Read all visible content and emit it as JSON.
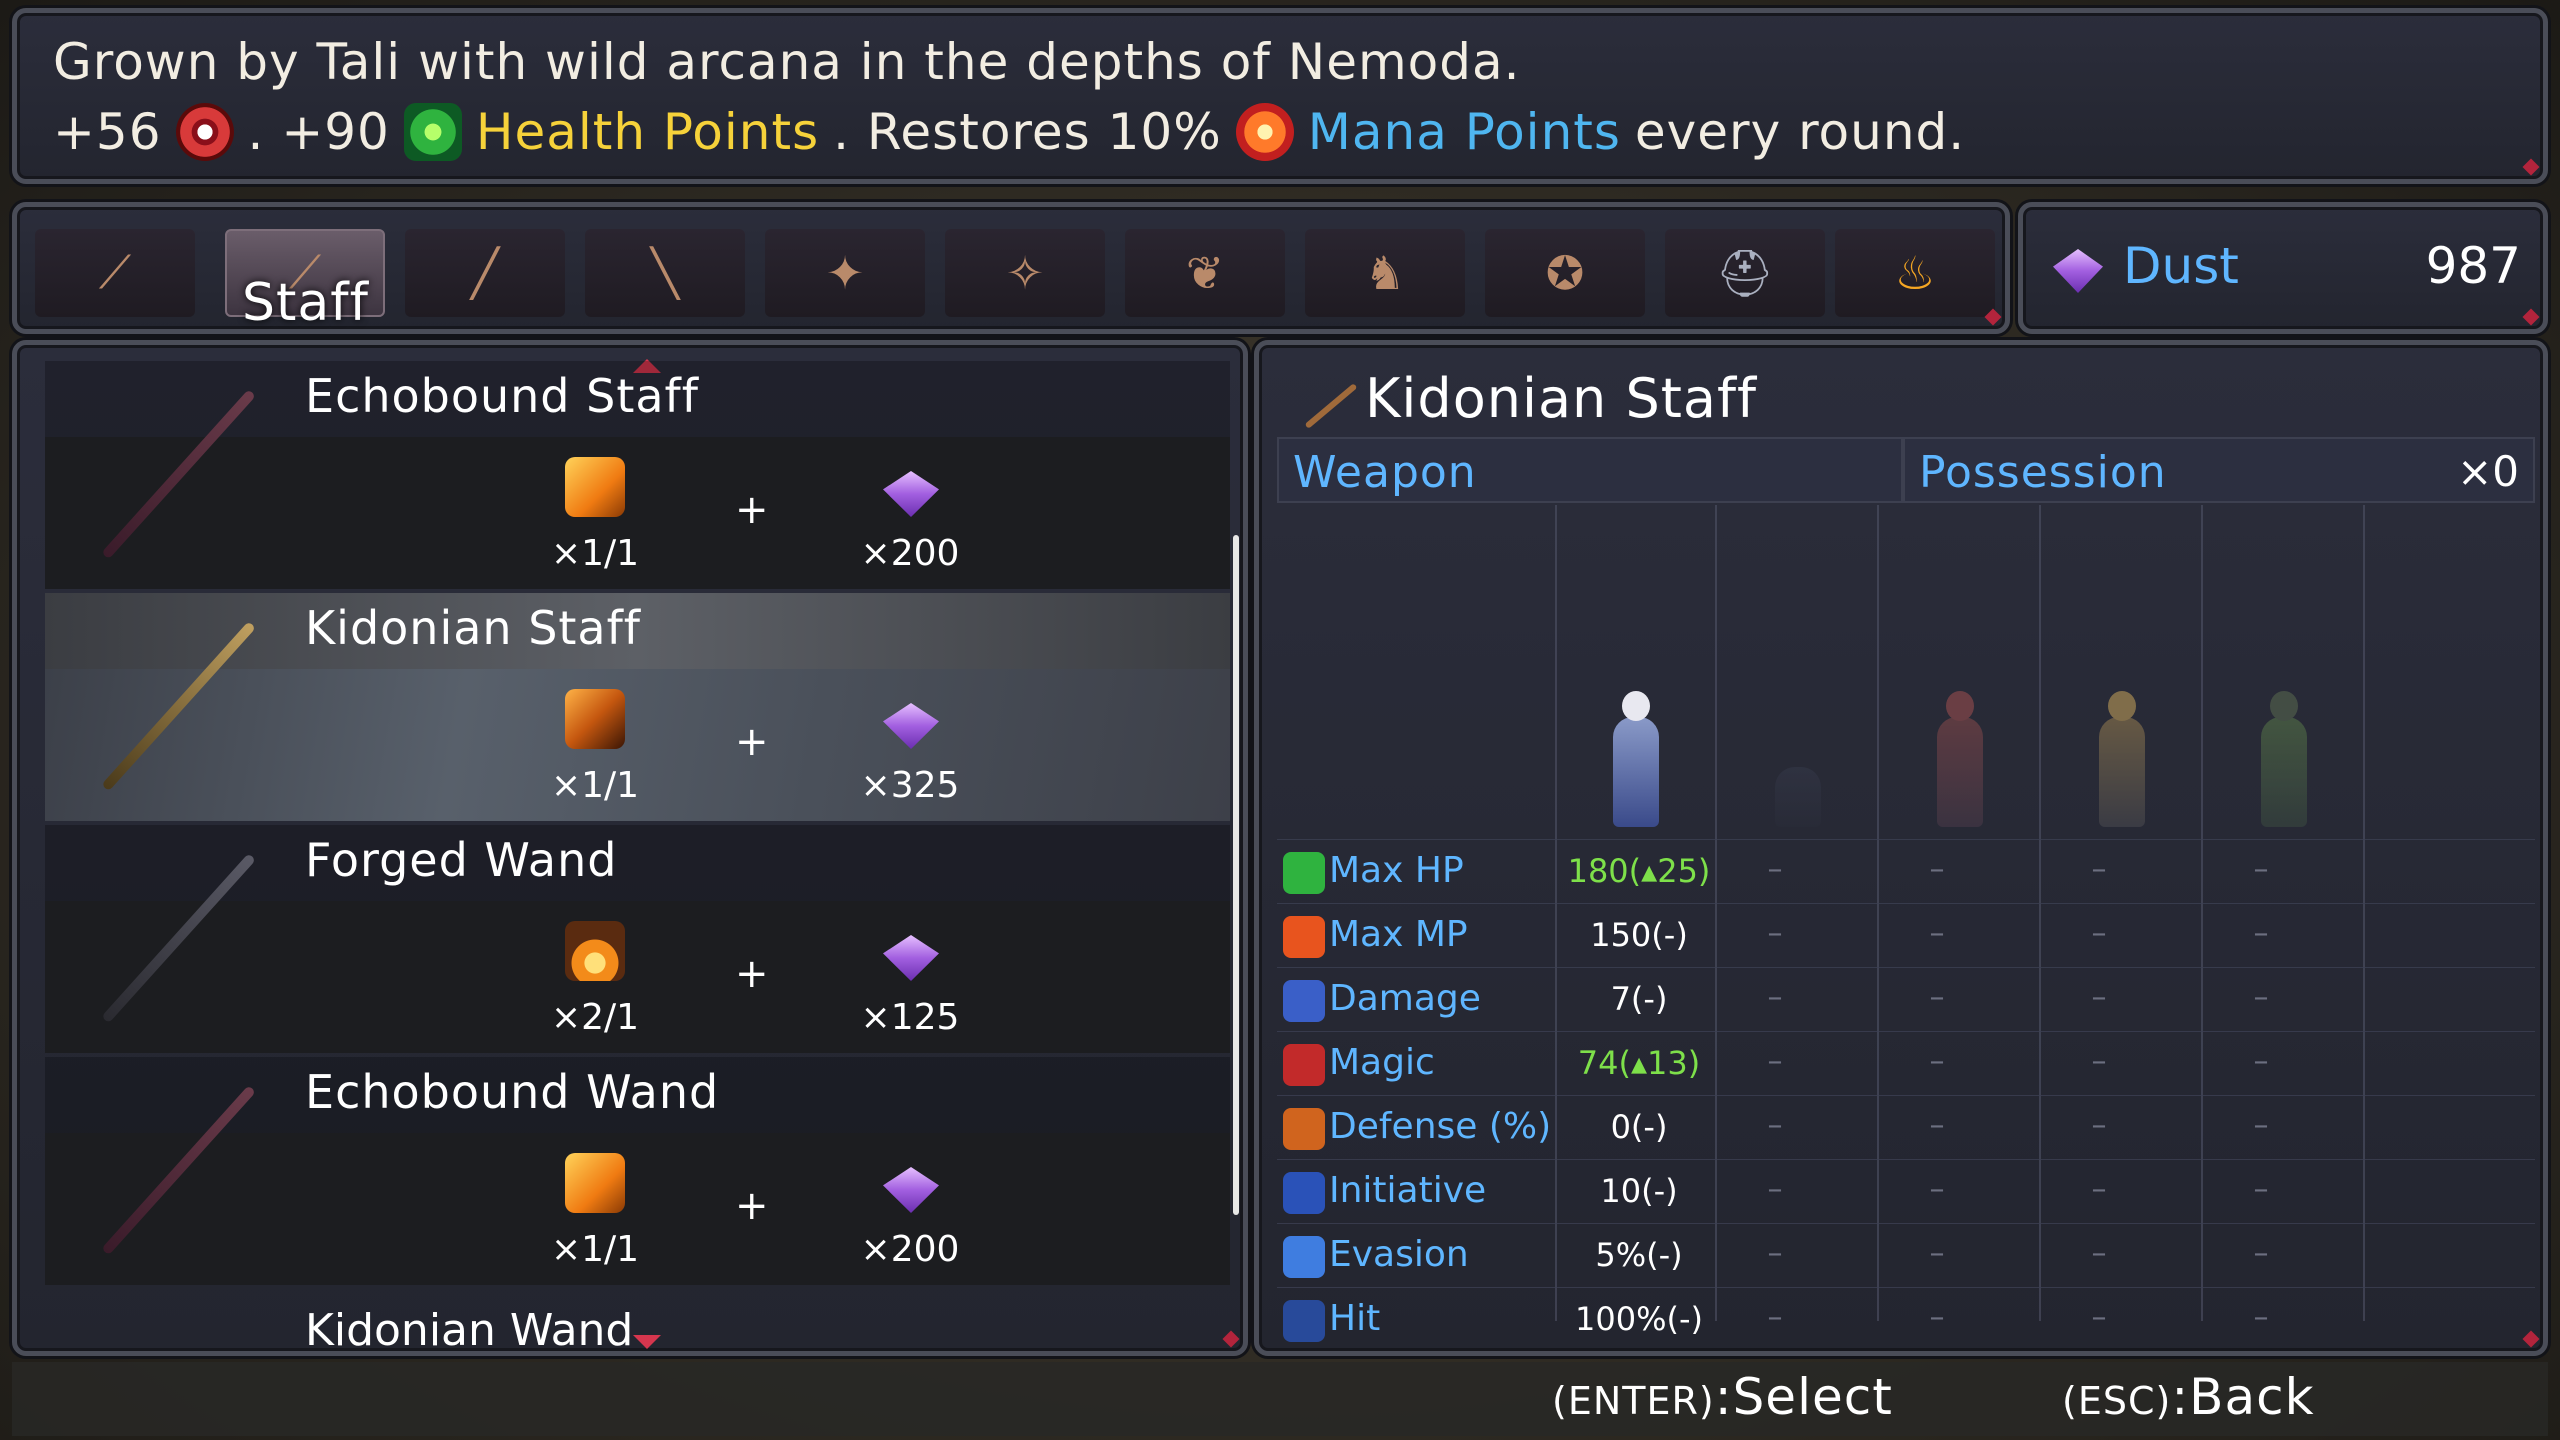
{
  "description": {
    "line1": "Grown by Tali with wild arcana in the depths of Nemoda.",
    "line2_prefix": "+56",
    "line2_sep": ". +90",
    "health_points": "Health Points",
    "restores": ". Restores 10%",
    "mana_points": "Mana Points",
    "every_round": "every round.",
    "icons": [
      "magic-eye-icon",
      "health-leaf-icon",
      "mana-orb-icon"
    ]
  },
  "tabs": {
    "active_label": "Staff",
    "items": [
      "staff",
      "wand",
      "blade",
      "dagger",
      "gloves",
      "robe",
      "boots",
      "bracers",
      "armor",
      "helmet",
      "ember"
    ]
  },
  "dust": {
    "label": "Dust",
    "value": "987"
  },
  "recipes": [
    {
      "name": "Echobound Staff",
      "material_count": "×1/1",
      "dust_count": "×200",
      "material_icon": "amber-shard-icon"
    },
    {
      "name": "Kidonian Staff",
      "material_count": "×1/1",
      "dust_count": "×325",
      "material_icon": "bark-plank-icon"
    },
    {
      "name": "Forged Wand",
      "material_count": "×2/1",
      "dust_count": "×125",
      "material_icon": "ember-icon"
    },
    {
      "name": "Echobound Wand",
      "material_count": "×1/1",
      "dust_count": "×200",
      "material_icon": "amber-shard-icon"
    }
  ],
  "recipe_partial": "Kidonian Wand",
  "plus": "+",
  "detail": {
    "title": "Kidonian Staff",
    "type_label": "Weapon",
    "possession_label": "Possession",
    "possession_count": "×0",
    "stats": [
      {
        "label": "Max HP",
        "value": "180(▴25)",
        "up": true,
        "icon_color": "#2fb33f"
      },
      {
        "label": "Max MP",
        "value": "150(-)",
        "up": false,
        "icon_color": "#e8541e"
      },
      {
        "label": "Damage",
        "value": "7(-)",
        "up": false,
        "icon_color": "#3a5fc8"
      },
      {
        "label": "Magic",
        "value": "74(▴13)",
        "up": true,
        "icon_color": "#c22a2a"
      },
      {
        "label": "Defense (%)",
        "value": "0(-)",
        "up": false,
        "icon_color": "#d0641e"
      },
      {
        "label": "Initiative",
        "value": "10(-)",
        "up": false,
        "icon_color": "#2a52b8"
      },
      {
        "label": "Evasion",
        "value": "5%(-)",
        "up": false,
        "icon_color": "#3f7de0"
      },
      {
        "label": "Hit",
        "value": "100%(-)",
        "up": false,
        "icon_color": "#284a9a"
      }
    ],
    "other_value": "–"
  },
  "footer": {
    "select_key": "(ENTER)",
    "select_label": ":Select",
    "back_key": "(ESC)",
    "back_label": ":Back"
  }
}
